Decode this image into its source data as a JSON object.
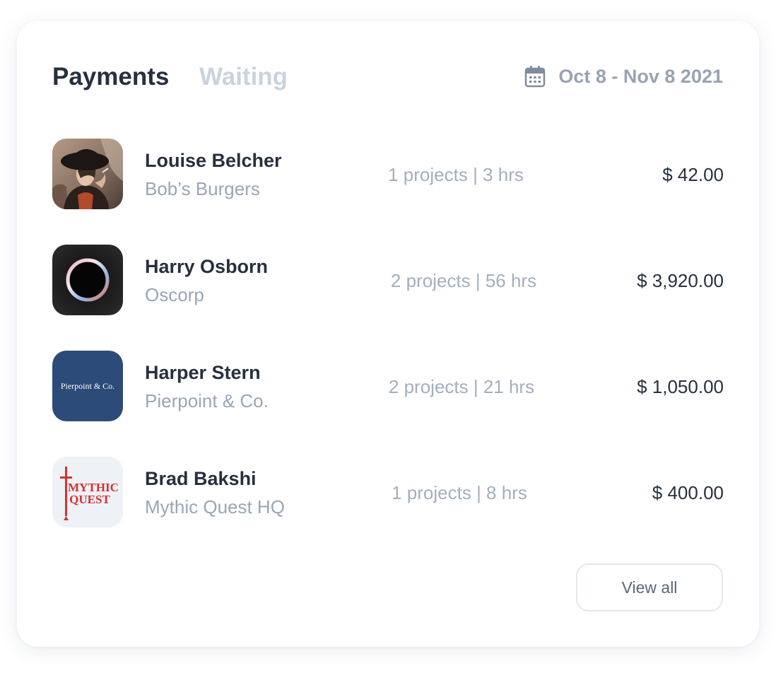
{
  "tabs": [
    {
      "label": "Payments",
      "active": true
    },
    {
      "label": "Waiting",
      "active": false
    }
  ],
  "date_range": {
    "icon": "calendar-icon",
    "label": "Oct 8 - Nov 8 2021"
  },
  "payments": [
    {
      "name": "Louise Belcher",
      "company": "Bob’s Burgers",
      "meta": "1 projects | 3 hrs",
      "amount": "$ 42.00",
      "avatar": "portrait-photo"
    },
    {
      "name": "Harry Osborn",
      "company": "Oscorp",
      "meta": "2 projects | 56 hrs",
      "amount": "$ 3,920.00",
      "avatar": "ring-logo"
    },
    {
      "name": "Harper Stern",
      "company": "Pierpoint & Co.",
      "meta": "2 projects | 21 hrs",
      "amount": "$ 1,050.00",
      "avatar": "pierpoint-logo",
      "avatar_text": "Pierpoint & Co."
    },
    {
      "name": "Brad Bakshi",
      "company": "Mythic Quest HQ",
      "meta": "1 projects | 8 hrs",
      "amount": "$ 400.00",
      "avatar": "mythic-quest-logo",
      "avatar_text": [
        "MYTHIC",
        "QUEST"
      ]
    }
  ],
  "view_all_label": "View all",
  "colors": {
    "title": "#26303f",
    "inactive_tab": "#c9d3df",
    "muted_text": "#98a6b6",
    "pierpoint_bg": "#2c4b78",
    "mythic_red": "#d8302f"
  }
}
